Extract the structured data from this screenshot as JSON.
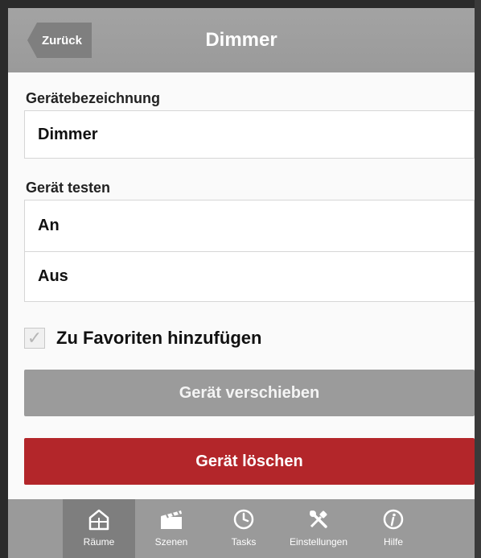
{
  "header": {
    "back_label": "Zurück",
    "title": "Dimmer"
  },
  "name_section": {
    "label": "Gerätebezeichnung",
    "value": "Dimmer"
  },
  "test_section": {
    "label": "Gerät testen",
    "options": [
      "An",
      "Aus"
    ]
  },
  "favorite": {
    "label": "Zu Favoriten hinzufügen",
    "checked": true
  },
  "buttons": {
    "move": "Gerät verschieben",
    "delete": "Gerät löschen"
  },
  "tabs": [
    {
      "label": "Räume",
      "icon": "house-icon",
      "active": true
    },
    {
      "label": "Szenen",
      "icon": "clapperboard-icon",
      "active": false
    },
    {
      "label": "Tasks",
      "icon": "clock-icon",
      "active": false
    },
    {
      "label": "Einstellungen",
      "icon": "tools-icon",
      "active": false
    },
    {
      "label": "Hilfe",
      "icon": "info-icon",
      "active": false
    }
  ],
  "colors": {
    "header": "#9e9e9e",
    "back_button": "#7f7f7f",
    "move_button": "#9b9b9b",
    "delete_button": "#b3262a",
    "tabbar": "#9a9a9a",
    "tab_active": "#7e7e7e"
  }
}
